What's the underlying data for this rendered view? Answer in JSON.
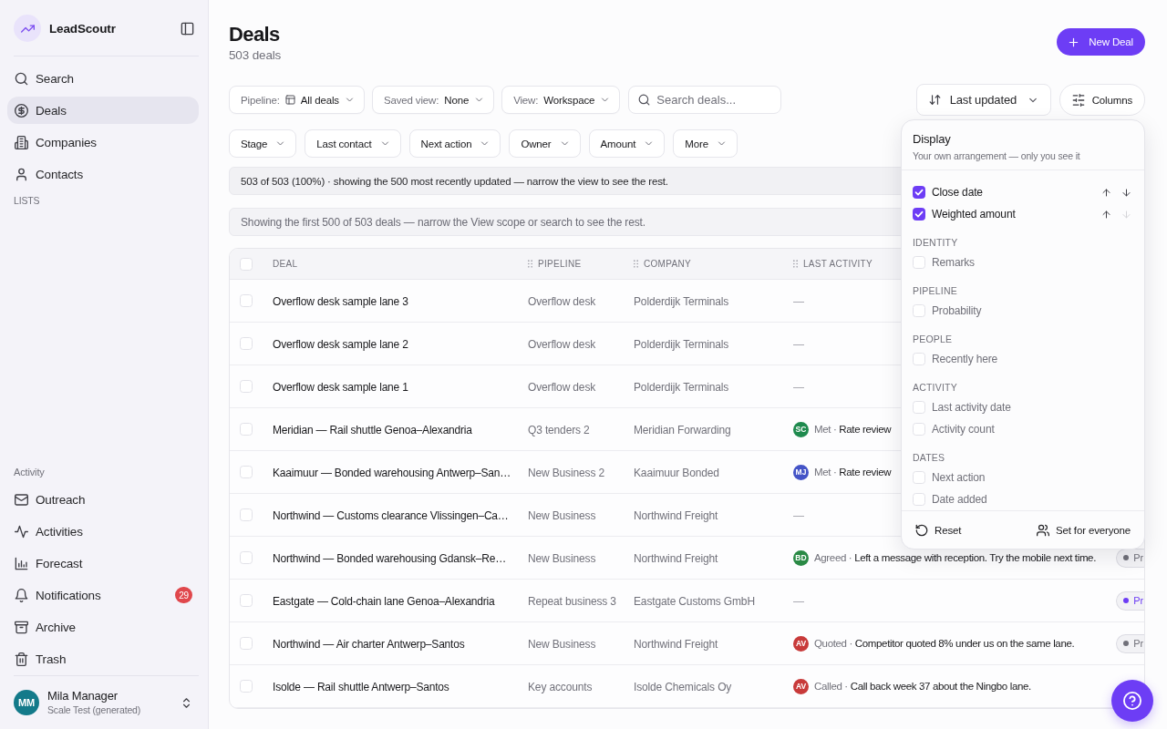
{
  "sidebar": {
    "brand": "LeadScoutr",
    "nav": [
      {
        "label": "Search",
        "selected": false
      },
      {
        "label": "Deals",
        "selected": true
      },
      {
        "label": "Companies",
        "selected": false
      },
      {
        "label": "Contacts",
        "selected": false
      }
    ],
    "lists_label": "LISTS",
    "activity_label": "Activity",
    "activity_nav": [
      {
        "label": "Outreach",
        "selected": false
      },
      {
        "label": "Activities",
        "selected": false
      },
      {
        "label": "Forecast",
        "selected": false
      },
      {
        "label": "Notifications",
        "selected": false,
        "badge": "29"
      },
      {
        "label": "Archive",
        "selected": false
      },
      {
        "label": "Trash",
        "selected": false
      }
    ],
    "user": {
      "initials": "MM",
      "name": "Mila Manager",
      "workspace": "Scale Test (generated)"
    }
  },
  "header": {
    "title": "Deals",
    "count": "503 deals",
    "new_button": "New Deal"
  },
  "filters": [
    {
      "kind": "pipeline",
      "label": "Pipeline:",
      "value": "All deals"
    },
    {
      "kind": "select",
      "label": "Saved view:",
      "value": "None"
    },
    {
      "kind": "select",
      "label": "View:",
      "value": "Workspace"
    }
  ],
  "search": {
    "placeholder": "Search deals..."
  },
  "sort": {
    "label": "Last updated"
  },
  "columns_button": "Columns",
  "quick_filters": [
    "Stage",
    "Last contact",
    "Next action",
    "Owner",
    "Amount",
    "More"
  ],
  "notices": [
    {
      "kind": "info",
      "text": "503 of 503 (100%) · showing the 500 most recently updated — narrow the view to see the rest."
    },
    {
      "kind": "muted",
      "text": "Showing the first 500 of 503 deals — narrow the View scope or search to see the rest."
    }
  ],
  "table": {
    "all_selected": false,
    "columns": [
      {
        "label": "DEAL",
        "draggable": false
      },
      {
        "label": "PIPELINE",
        "draggable": true
      },
      {
        "label": "COMPANY",
        "draggable": true
      },
      {
        "label": "LAST ACTIVITY",
        "draggable": true
      }
    ],
    "rows": [
      {
        "selected": false,
        "deal": "Overflow desk sample lane 3",
        "pipeline": "Overflow desk",
        "company": "Polderdijk Terminals",
        "last_activity": {
          "kind": "none",
          "text": "—"
        }
      },
      {
        "selected": false,
        "deal": "Overflow desk sample lane 2",
        "pipeline": "Overflow desk",
        "company": "Polderdijk Terminals",
        "last_activity": {
          "kind": "none",
          "text": "—"
        }
      },
      {
        "selected": false,
        "deal": "Overflow desk sample lane 1",
        "pipeline": "Overflow desk",
        "company": "Polderdijk Terminals",
        "last_activity": {
          "kind": "none",
          "text": "—"
        }
      },
      {
        "selected": false,
        "deal": "Meridian — Rail shuttle Genoa–Alexandria",
        "pipeline": "Q3 tenders 2",
        "company": "Meridian Forwarding",
        "last_activity": {
          "kind": "entry",
          "initials": "SC",
          "color": "#1f8a4e",
          "status": "Met ·",
          "note": "Rate review"
        }
      },
      {
        "selected": false,
        "deal": "Kaaimuur — Bonded warehousing Antwerp–San…",
        "pipeline": "New Business 2",
        "company": "Kaaimuur Bonded",
        "last_activity": {
          "kind": "entry",
          "initials": "MJ",
          "color": "#4454c7",
          "status": "Met ·",
          "note": "Rate review"
        }
      },
      {
        "selected": false,
        "deal": "Northwind — Customs clearance Vlissingen–Ca…",
        "pipeline": "New Business",
        "company": "Northwind Freight",
        "last_activity": {
          "kind": "none",
          "text": "—"
        }
      },
      {
        "selected": false,
        "deal": "Northwind — Bonded warehousing Gdansk–Re…",
        "pipeline": "New Business",
        "company": "Northwind Freight",
        "last_activity": {
          "kind": "entry",
          "initials": "BD",
          "color": "#2a8a45",
          "status": "Agreed ·",
          "note": "Left a message with reception. Try the mobile next time."
        },
        "stage": {
          "label": "Pr",
          "color": "#71717a"
        }
      },
      {
        "selected": false,
        "deal": "Eastgate — Cold-chain lane Genoa–Alexandria",
        "pipeline": "Repeat business 3",
        "company": "Eastgate Customs GmbH",
        "last_activity": {
          "kind": "none",
          "text": "—"
        },
        "stage": {
          "label": "Pr",
          "color": "#6d3df5"
        }
      },
      {
        "selected": false,
        "deal": "Northwind — Air charter Antwerp–Santos",
        "pipeline": "New Business",
        "company": "Northwind Freight",
        "last_activity": {
          "kind": "entry",
          "initials": "AV",
          "color": "#c83a3a",
          "status": "Quoted ·",
          "note": "Competitor quoted 8% under us on the same lane."
        },
        "stage": {
          "label": "Pr",
          "color": "#71717a"
        }
      },
      {
        "selected": false,
        "deal": "Isolde — Rail shuttle Antwerp–Santos",
        "pipeline": "Key accounts",
        "company": "Isolde Chemicals Oy",
        "last_activity": {
          "kind": "entry",
          "initials": "AV",
          "color": "#c83a3a",
          "status": "Called ·",
          "note": "Call back week 37 about the Ningbo lane."
        }
      }
    ]
  },
  "columns_panel": {
    "title": "Display",
    "subtitle": "Your own arrangement — only you see it",
    "groups": [
      {
        "items": [
          {
            "label": "Close date",
            "checked": true,
            "move": {
              "up_disabled": false,
              "down_disabled": false
            }
          },
          {
            "label": "Weighted amount",
            "checked": true,
            "move": {
              "up_disabled": false,
              "down_disabled": true
            }
          }
        ]
      },
      {
        "title": "IDENTITY",
        "items": [
          {
            "label": "Remarks",
            "checked": false
          }
        ]
      },
      {
        "title": "PIPELINE",
        "items": [
          {
            "label": "Probability",
            "checked": false
          }
        ]
      },
      {
        "title": "PEOPLE",
        "items": [
          {
            "label": "Recently here",
            "checked": false
          }
        ]
      },
      {
        "title": "ACTIVITY",
        "items": [
          {
            "label": "Last activity date",
            "checked": false
          },
          {
            "label": "Activity count",
            "checked": false
          }
        ]
      },
      {
        "title": "DATES",
        "items": [
          {
            "label": "Next action",
            "checked": false
          },
          {
            "label": "Date added",
            "checked": false
          }
        ]
      }
    ],
    "reset": "Reset",
    "share": "Set for everyone"
  }
}
